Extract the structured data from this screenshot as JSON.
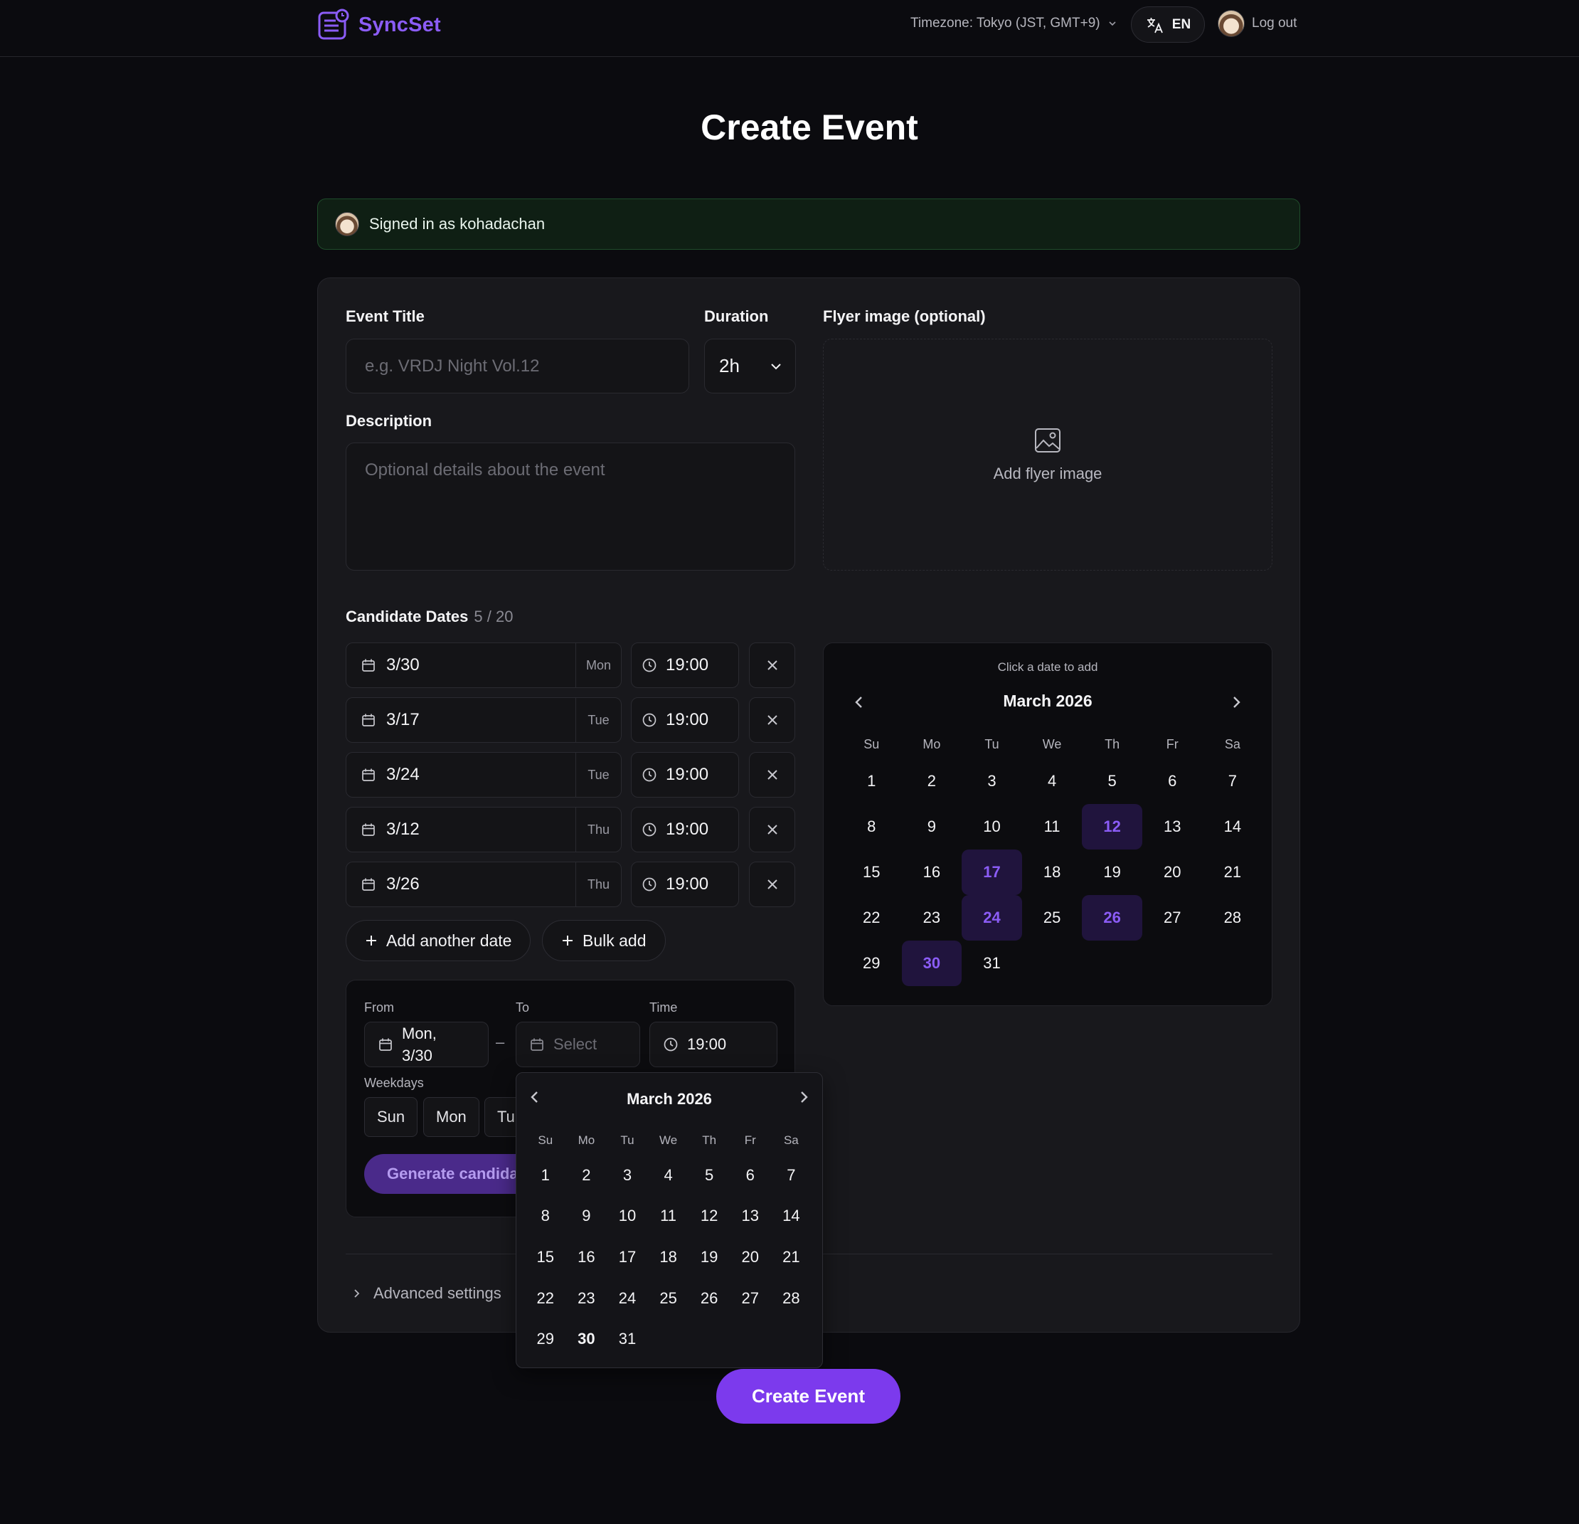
{
  "header": {
    "brand": "SyncSet",
    "timezone": "Timezone: Tokyo (JST, GMT+9)",
    "language": "EN",
    "logout": "Log out"
  },
  "page_title": "Create Event",
  "signed_in": "Signed in as kohadachan",
  "form": {
    "title_label": "Event Title",
    "title_placeholder": "e.g. VRDJ Night Vol.12",
    "duration_label": "Duration",
    "duration_value": "2h",
    "description_label": "Description",
    "description_placeholder": "Optional details about the event",
    "flyer_label": "Flyer image (optional)",
    "flyer_button": "Add flyer image"
  },
  "candidates": {
    "label": "Candidate Dates",
    "count": "5 / 20",
    "rows": [
      {
        "date": "3/30",
        "dow": "Mon",
        "time": "19:00"
      },
      {
        "date": "3/17",
        "dow": "Tue",
        "time": "19:00"
      },
      {
        "date": "3/24",
        "dow": "Tue",
        "time": "19:00"
      },
      {
        "date": "3/12",
        "dow": "Thu",
        "time": "19:00"
      },
      {
        "date": "3/26",
        "dow": "Thu",
        "time": "19:00"
      }
    ],
    "add_date": "Add another date",
    "bulk_add": "Bulk add"
  },
  "bulk": {
    "from_label": "From",
    "from_value_line1": "Mon,",
    "from_value_line2": "3/30",
    "dash": "–",
    "to_label": "To",
    "to_placeholder": "Select",
    "time_label": "Time",
    "time_value": "19:00",
    "weekdays_label": "Weekdays",
    "weekdays": [
      "Sun",
      "Mon",
      "Tu"
    ],
    "generate": "Generate candida"
  },
  "advanced": "Advanced settings",
  "calendar": {
    "hint": "Click a date to add",
    "month": "March 2026",
    "weekday_headers": [
      "Su",
      "Mo",
      "Tu",
      "We",
      "Th",
      "Fr",
      "Sa"
    ],
    "days": [
      "1",
      "2",
      "3",
      "4",
      "5",
      "6",
      "7",
      "8",
      "9",
      "10",
      "11",
      "12",
      "13",
      "14",
      "15",
      "16",
      "17",
      "18",
      "19",
      "20",
      "21",
      "22",
      "23",
      "24",
      "25",
      "26",
      "27",
      "28",
      "29",
      "30",
      "31"
    ],
    "selected": [
      "12",
      "17",
      "24",
      "26",
      "30"
    ]
  },
  "popup_calendar": {
    "month": "March 2026",
    "weekday_headers": [
      "Su",
      "Mo",
      "Tu",
      "We",
      "Th",
      "Fr",
      "Sa"
    ],
    "days": [
      "1",
      "2",
      "3",
      "4",
      "5",
      "6",
      "7",
      "8",
      "9",
      "10",
      "11",
      "12",
      "13",
      "14",
      "15",
      "16",
      "17",
      "18",
      "19",
      "20",
      "21",
      "22",
      "23",
      "24",
      "25",
      "26",
      "27",
      "28",
      "29",
      "30",
      "31"
    ],
    "bold": "30"
  },
  "create_button": "Create Event",
  "colors": {
    "accent": "#7c3aed",
    "brand": "#8b5cf6",
    "background": "#0b0b0f",
    "card": "#18181c",
    "success_bg": "#0f1f14"
  },
  "icons": {
    "brand": "calendar-list-icon",
    "language": "translate-icon",
    "date": "calendar-icon",
    "time": "clock-icon",
    "remove": "close-icon",
    "add": "plus-icon",
    "flyer": "image-icon"
  }
}
